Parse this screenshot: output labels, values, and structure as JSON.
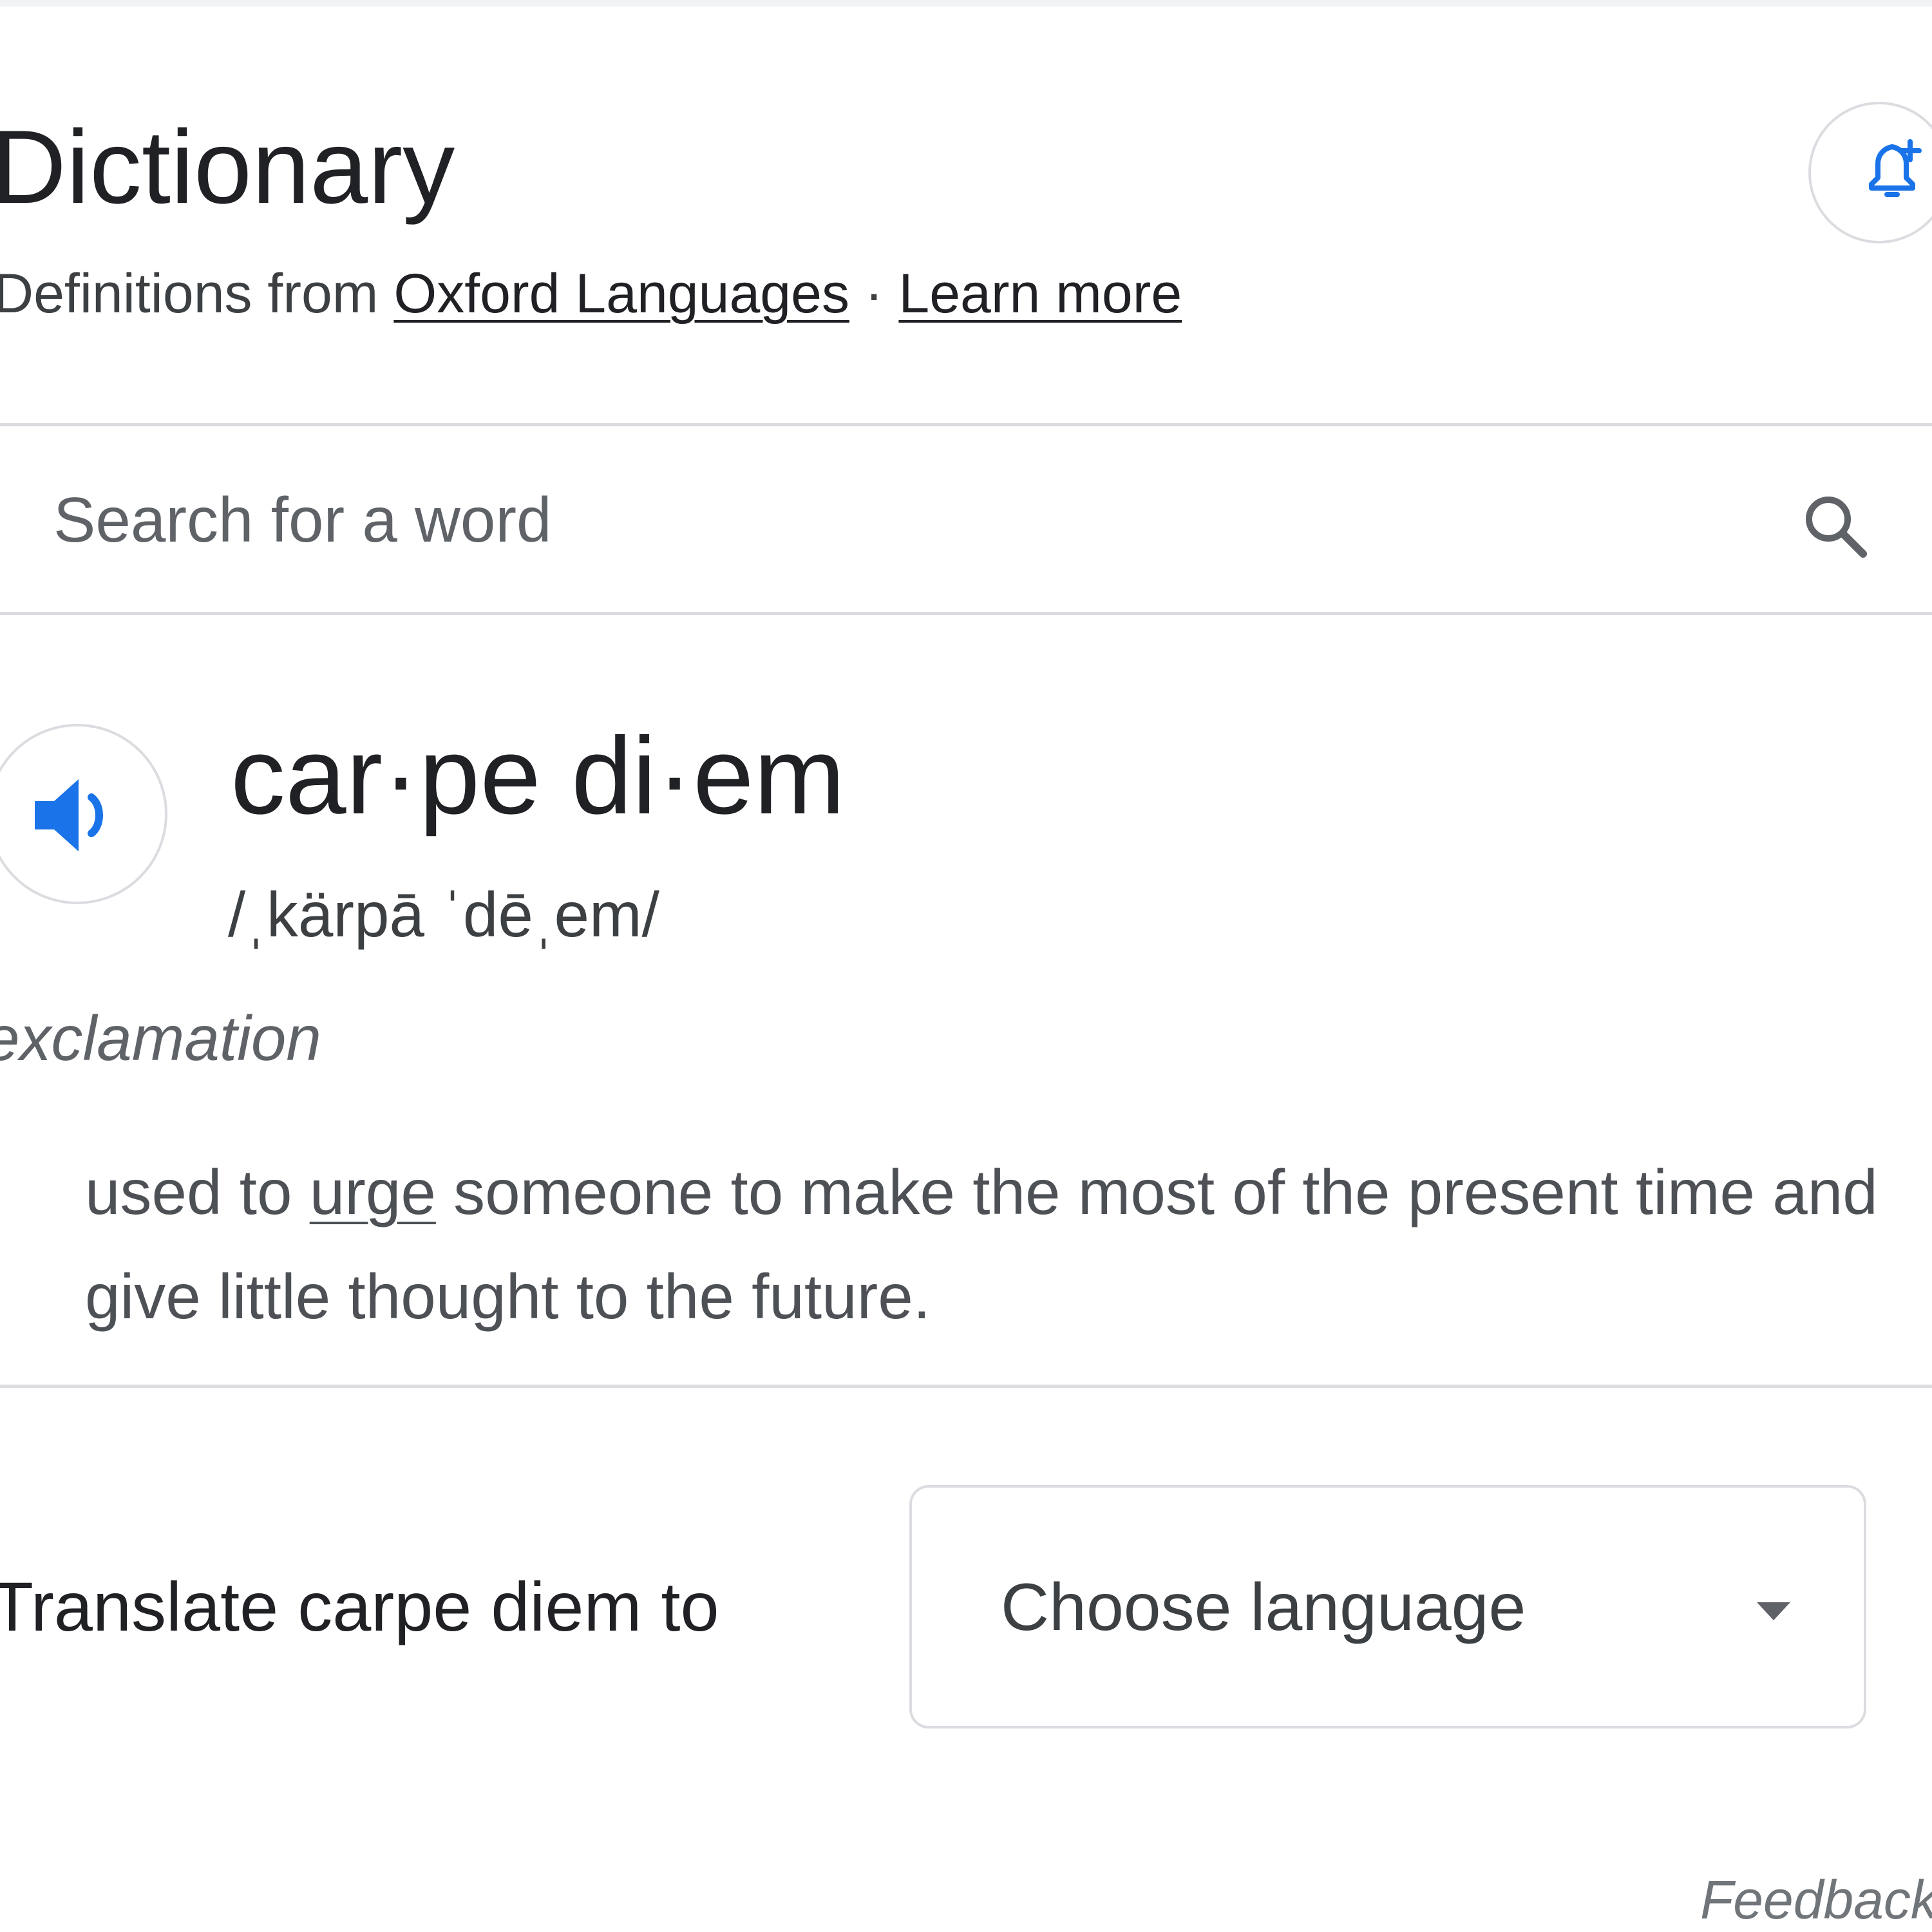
{
  "header": {
    "title": "Dictionary",
    "source_prefix": "Definitions from ",
    "source_link": "Oxford Languages",
    "separator": " · ",
    "learn_more": "Learn more",
    "alert_icon": "bell-plus-icon"
  },
  "search": {
    "placeholder": "Search for a word",
    "value": "",
    "icon": "search-icon"
  },
  "entry": {
    "speaker_icon": "speaker-icon",
    "headword": "car·pe di·em",
    "phonetic": "/ˌkärpā ˈdēˌem/",
    "part_of_speech": "exclamation",
    "definition_before": "used to ",
    "definition_link": "urge",
    "definition_after": " someone to make the most of the present time and give little thought to the future."
  },
  "translate": {
    "label": "Translate carpe diem to",
    "select_text": "Choose language",
    "dropdown_icon": "caret-down-icon"
  },
  "footer": {
    "feedback": "Feedback"
  },
  "colors": {
    "accent_blue": "#1a73e8",
    "border": "#dadce0",
    "text_primary": "#202124",
    "text_secondary": "#4d5156"
  }
}
